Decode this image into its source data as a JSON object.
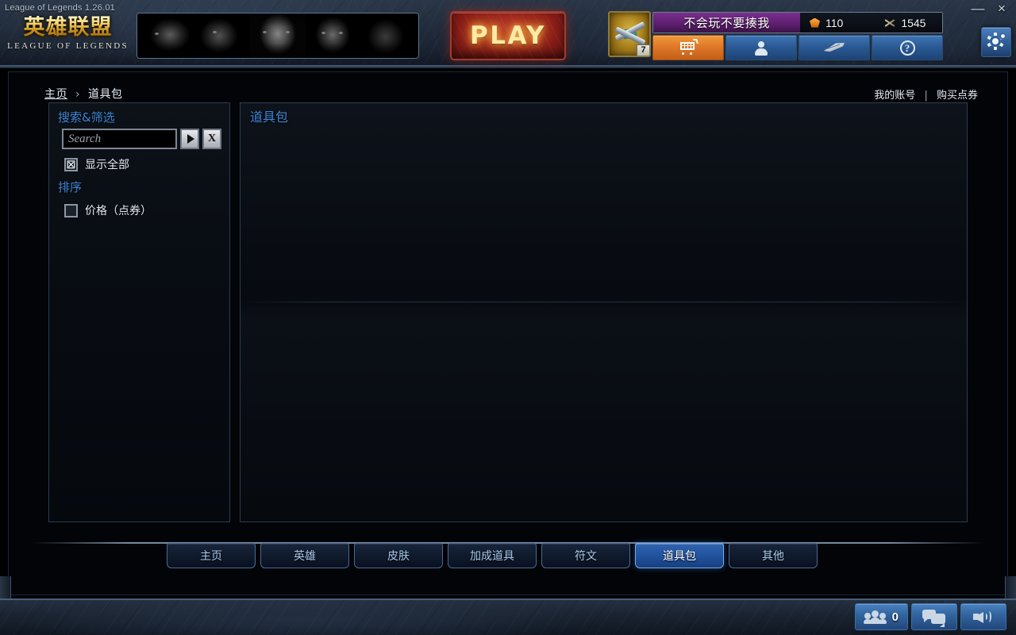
{
  "window": {
    "title": "League of Legends 1.26.01",
    "minimize_label": "—",
    "close_label": "×"
  },
  "logo": {
    "cn": "英雄联盟",
    "en": "LEAGUE OF LEGENDS"
  },
  "header": {
    "play_label": "PLAY",
    "summoner_level": "7",
    "summoner_name": "不会玩不要揍我",
    "rp_value": "110",
    "ip_value": "1545",
    "rp_icon": "rp-gem-icon",
    "ip_icon": "ip-crossed-swords-icon",
    "nav": [
      {
        "name": "store",
        "icon": "shopping-cart-icon",
        "active": true
      },
      {
        "name": "profile",
        "icon": "person-icon",
        "active": false
      },
      {
        "name": "runes",
        "icon": "quill-icon",
        "active": false
      },
      {
        "name": "help",
        "icon": "question-mark-icon",
        "active": false
      }
    ],
    "settings_icon": "gear-icon"
  },
  "breadcrumb": {
    "home": "主页",
    "separator": "›",
    "current": "道具包"
  },
  "account_links": {
    "my_account": "我的账号",
    "separator": "|",
    "buy_rp": "购买点券"
  },
  "sidebar": {
    "search_heading": "搜索&筛选",
    "search_placeholder": "Search",
    "search_value": "",
    "submit_label": "▶",
    "clear_label": "X",
    "show_all": {
      "label": "显示全部",
      "checked": true,
      "mark": "☒"
    },
    "sort_heading": "排序",
    "sort_price": {
      "label": "价格（点券）",
      "checked": false,
      "mark": ""
    }
  },
  "content": {
    "title": "道具包",
    "items": []
  },
  "tabs": [
    {
      "label": "主页",
      "active": false
    },
    {
      "label": "英雄",
      "active": false
    },
    {
      "label": "皮肤",
      "active": false
    },
    {
      "label": "加成道具",
      "active": false
    },
    {
      "label": "符文",
      "active": false
    },
    {
      "label": "道具包",
      "active": true
    },
    {
      "label": "其他",
      "active": false
    }
  ],
  "statusbar": {
    "friends_count": "0",
    "friends_icon": "friends-group-icon",
    "chat_icon": "chat-bubbles-icon",
    "volume_icon": "speaker-icon"
  },
  "colors": {
    "accent_blue": "#3e86d6",
    "store_orange": "#e0782a",
    "name_purple": "#5d1f6e",
    "play_red": "#8f1f19"
  }
}
